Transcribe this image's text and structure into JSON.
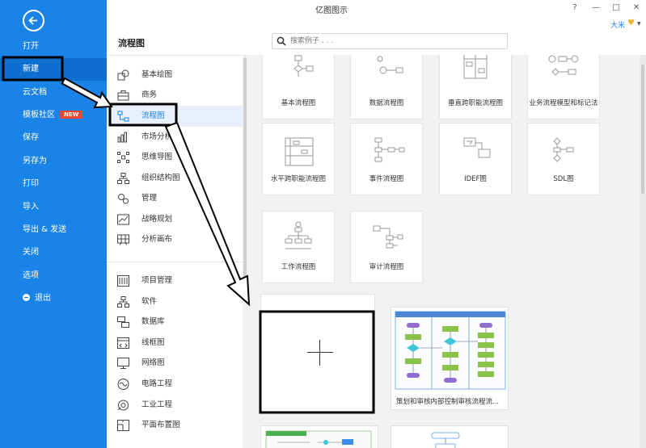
{
  "window": {
    "title": "亿图图示",
    "controls": [
      "?",
      "—",
      "□",
      "✕"
    ],
    "user": {
      "name": "大米"
    }
  },
  "nav": {
    "items": [
      {
        "label": "打开"
      },
      {
        "label": "新建",
        "active": true
      },
      {
        "label": "云文档"
      },
      {
        "label": "模板社区",
        "badge": "NEW"
      },
      {
        "label": "保存"
      },
      {
        "label": "另存为"
      },
      {
        "label": "打印"
      },
      {
        "label": "导入"
      },
      {
        "label": "导出 & 发送"
      },
      {
        "label": "关闭"
      },
      {
        "label": "选项"
      },
      {
        "label": "退出"
      }
    ]
  },
  "header": {
    "section_title": "流程图",
    "search_placeholder": "搜索例子 . . ."
  },
  "categories": [
    {
      "label": "基本绘图",
      "icon": "shapes-icon"
    },
    {
      "label": "商务",
      "icon": "briefcase-icon"
    },
    {
      "label": "流程图",
      "icon": "flowchart-icon",
      "selected": true
    },
    {
      "label": "市场分析",
      "icon": "bar-chart-icon"
    },
    {
      "label": "思维导图",
      "icon": "mindmap-icon"
    },
    {
      "label": "组织结构图",
      "icon": "org-chart-icon"
    },
    {
      "label": "管理",
      "icon": "gears-icon"
    },
    {
      "label": "战略规划",
      "icon": "line-chart-icon"
    },
    {
      "label": "分析画布",
      "icon": "canvas-icon"
    },
    {
      "label": "项目管理",
      "icon": "gantt-icon"
    },
    {
      "label": "软件",
      "icon": "software-icon"
    },
    {
      "label": "数据库",
      "icon": "database-icon"
    },
    {
      "label": "线框图",
      "icon": "wireframe-icon"
    },
    {
      "label": "网络图",
      "icon": "network-icon"
    },
    {
      "label": "电路工程",
      "icon": "circuit-icon"
    },
    {
      "label": "工业工程",
      "icon": "industrial-icon"
    },
    {
      "label": "平面布置图",
      "icon": "floorplan-icon"
    }
  ],
  "templates": [
    {
      "label": "基本流程图"
    },
    {
      "label": "数据流程图"
    },
    {
      "label": "垂直跨职能流程图"
    },
    {
      "label": "业务流程模型和标记法"
    },
    {
      "label": "水平跨职能流程图"
    },
    {
      "label": "事件流程图"
    },
    {
      "label": "IDEF图"
    },
    {
      "label": "SDL图"
    },
    {
      "label": "工作流程图"
    },
    {
      "label": "审计流程图"
    }
  ],
  "examples": {
    "blank_icon": "plus-icon",
    "sample": {
      "label": "策划和审核内部控制审核流程流..."
    }
  },
  "colors": {
    "nav_bg": "#1a83e8",
    "nav_active": "#0f6fd0",
    "selected_bg": "#e7f0fc",
    "badge": "#f0452e",
    "annotation": "#000000"
  }
}
